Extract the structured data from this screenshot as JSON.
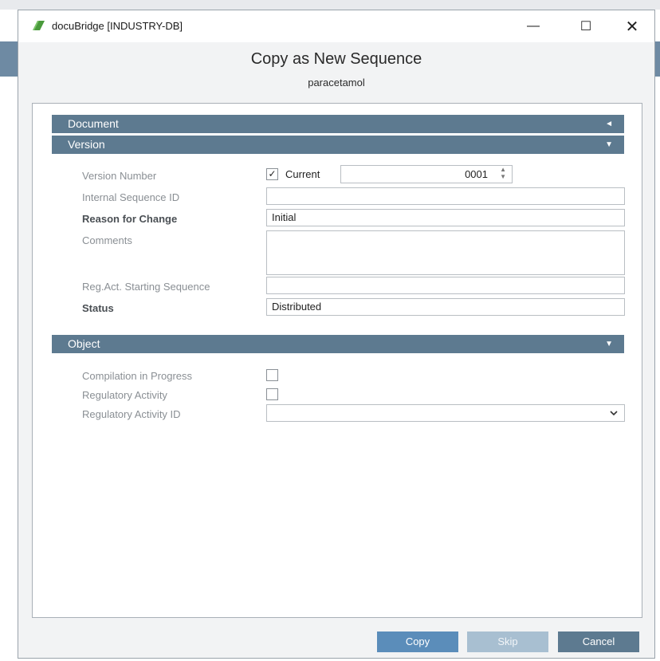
{
  "window": {
    "title": "docuBridge [INDUSTRY-DB]",
    "minimize": "—",
    "maximize": "☐",
    "close": "✕"
  },
  "dialog": {
    "title": "Copy as New Sequence",
    "subtitle": "paracetamol"
  },
  "sections": {
    "document": {
      "label": "Document",
      "arrow": "◄"
    },
    "version": {
      "label": "Version",
      "arrow": "▼"
    },
    "object": {
      "label": "Object",
      "arrow": "▼"
    }
  },
  "version": {
    "version_number_label": "Version Number",
    "current_label": "Current",
    "current_checked": true,
    "current_check_glyph": "✓",
    "version_number_value": "0001",
    "internal_sequence_id_label": "Internal Sequence ID",
    "internal_sequence_id_value": "",
    "reason_for_change_label": "Reason for Change",
    "reason_for_change_value": "Initial",
    "comments_label": "Comments",
    "comments_value": "",
    "reg_act_starting_sequence_label": "Reg.Act. Starting Sequence",
    "reg_act_starting_sequence_value": "",
    "status_label": "Status",
    "status_value": "Distributed"
  },
  "object": {
    "compilation_in_progress_label": "Compilation in Progress",
    "compilation_in_progress_checked": false,
    "regulatory_activity_label": "Regulatory Activity",
    "regulatory_activity_checked": false,
    "regulatory_activity_id_label": "Regulatory Activity ID",
    "regulatory_activity_id_value": ""
  },
  "buttons": {
    "copy": "Copy",
    "skip": "Skip",
    "cancel": "Cancel"
  },
  "colors": {
    "section_bar": "#5d7a90",
    "copy_button": "#5b8dba",
    "skip_button_disabled": "#a8bfd1",
    "cancel_button": "#5d7a90"
  }
}
